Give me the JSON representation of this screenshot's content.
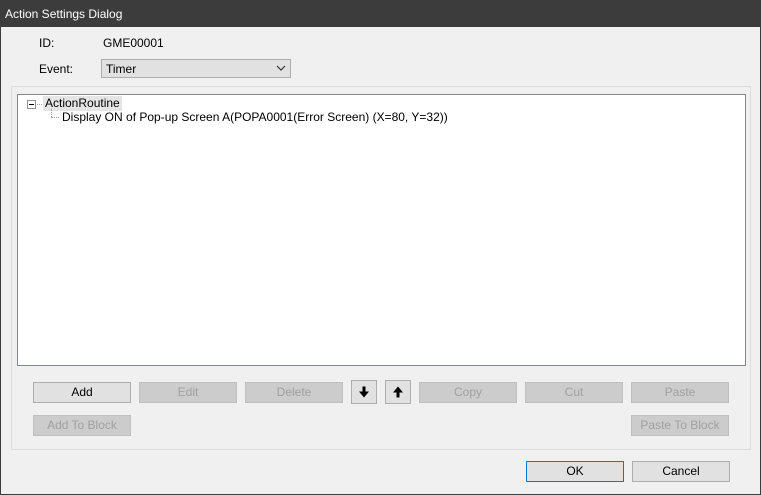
{
  "window": {
    "title": "Action Settings Dialog"
  },
  "fields": {
    "id_label": "ID:",
    "id_value": "GME00001",
    "event_label": "Event:",
    "event_value": "Timer"
  },
  "tree": {
    "root": "ActionRoutine",
    "children": [
      "Display ON of Pop-up Screen A(POPA0001(Error Screen) (X=80, Y=32))"
    ]
  },
  "toolbar": {
    "add": "Add",
    "edit": "Edit",
    "delete": "Delete",
    "move_down_icon": "arrow-down-icon",
    "move_up_icon": "arrow-up-icon",
    "copy": "Copy",
    "cut": "Cut",
    "paste": "Paste",
    "add_to_block": "Add To Block",
    "paste_to_block": "Paste To Block"
  },
  "footer": {
    "ok": "OK",
    "cancel": "Cancel"
  },
  "colors": {
    "titlebar": "#3c3c3c",
    "dialog_bg": "#f0f0f0",
    "button": "#e1e1e1",
    "disabled_text": "#a0a0a0",
    "focus_border": "#0078d7"
  }
}
